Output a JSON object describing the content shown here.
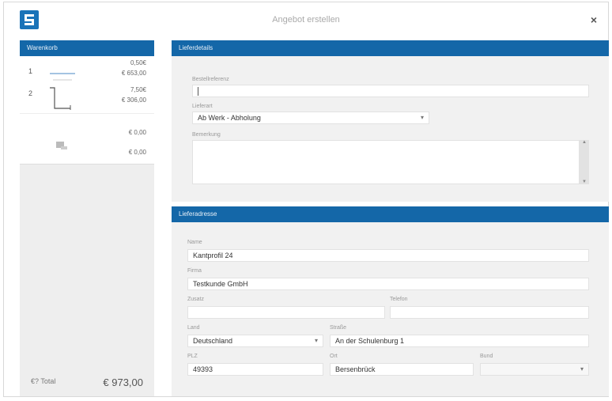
{
  "dialog": {
    "title": "Angebot erstellen",
    "close": "×"
  },
  "cart": {
    "header": "Warenkorb",
    "items": [
      {
        "pos": "1",
        "line1": "0,50€",
        "line2": "€ 653,00"
      },
      {
        "pos": "2",
        "line1": "7,50€",
        "line2": "€ 306,00"
      },
      {
        "pos": "",
        "line1": "€ 0,00",
        "line2": ""
      },
      {
        "pos": "",
        "line1": "€ 0,00",
        "line2": ""
      }
    ],
    "total_label": "€? Total",
    "total_value": "€ 973,00"
  },
  "delivery": {
    "header": "Lieferdetails",
    "ref_label": "Bestellreferenz",
    "ref_value": "",
    "mode_label": "Lieferart",
    "mode_value": "Ab Werk - Abholung",
    "note_label": "Bemerkung",
    "note_value": ""
  },
  "address": {
    "header": "Lieferadresse",
    "name_label": "Name",
    "name_value": "Kantprofil 24",
    "company_label": "Firma",
    "company_value": "Testkunde GmbH",
    "extra1_label": "Zusatz",
    "extra1_value": "",
    "extra2_label": "Telefon",
    "extra2_value": "",
    "country_label": "Land",
    "country_value": "Deutschland",
    "street_label": "Straße",
    "street_value": "An der Schulenburg 1",
    "zip_label": "PLZ",
    "zip_value": "49393",
    "city_label": "Ort",
    "city_value": "Bersenbrück",
    "state_label": "Bund",
    "state_value": ""
  }
}
